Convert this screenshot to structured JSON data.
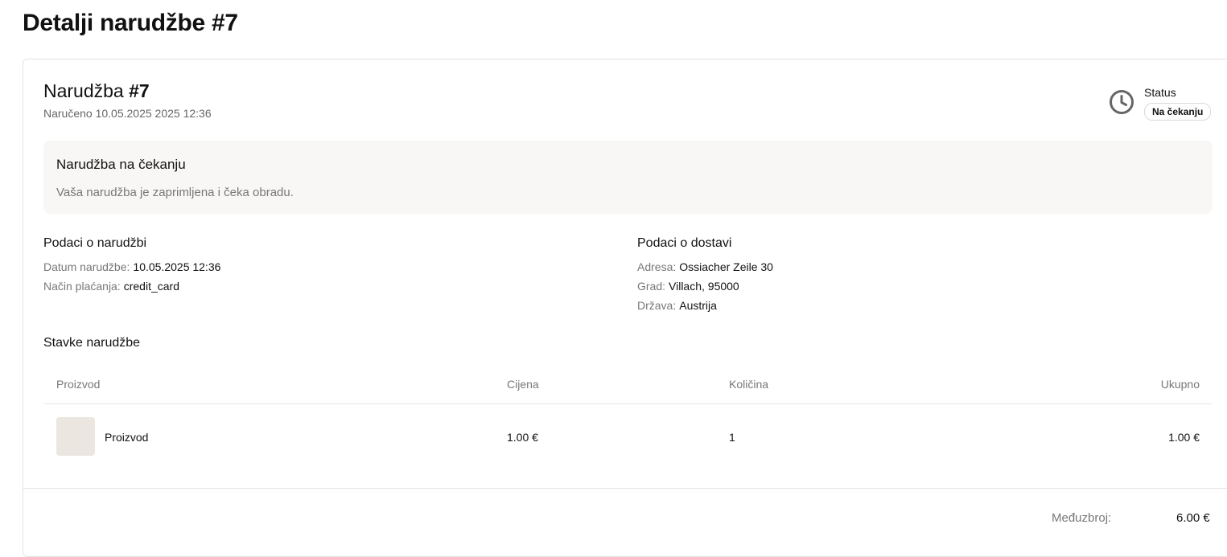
{
  "page": {
    "title": "Detalji narudžbe #7"
  },
  "order": {
    "title_prefix": "Narudžba",
    "title_number": "#7",
    "ordered_at": "Naručeno 10.05.2025 2025 12:36"
  },
  "status": {
    "icon": "clock-icon",
    "label": "Status",
    "value": "Na čekanju"
  },
  "notice": {
    "title": "Narudžba na čekanju",
    "text": "Vaša narudžba je zaprimljena i čeka obradu."
  },
  "order_info": {
    "heading": "Podaci o narudžbi",
    "rows": [
      {
        "key": "Datum narudžbe:",
        "value": "10.05.2025 12:36"
      },
      {
        "key": "Način plaćanja:",
        "value": "credit_card"
      }
    ]
  },
  "delivery_info": {
    "heading": "Podaci o dostavi",
    "rows": [
      {
        "key": "Adresa:",
        "value": "Ossiacher Zeile 30"
      },
      {
        "key": "Grad:",
        "value": "Villach, 95000"
      },
      {
        "key": "Država:",
        "value": "Austrija"
      }
    ]
  },
  "items": {
    "heading": "Stavke narudžbe",
    "columns": [
      "Proizvod",
      "Cijena",
      "Količina",
      "Ukupno"
    ],
    "rows": [
      {
        "product": "Proizvod",
        "price": "1.00 €",
        "quantity": "1",
        "total": "1.00 €"
      }
    ]
  },
  "summary": {
    "subtotal_label": "Međuzbroj:",
    "subtotal_value": "6.00 €"
  },
  "colors": {
    "text": "#111111",
    "muted": "#777777",
    "notice_bg": "#f8f7f5",
    "thumb_bg": "#ebe6e0",
    "border": "#e6e4e0"
  }
}
